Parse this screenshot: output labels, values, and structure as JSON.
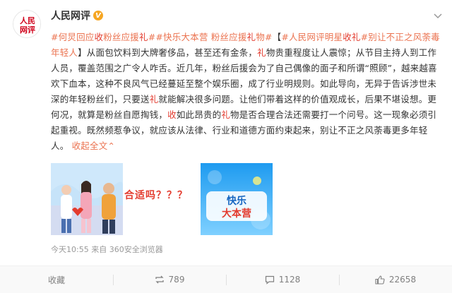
{
  "post": {
    "author": "人民网评",
    "verified_badge": "V",
    "logo_text": "人民\n网评",
    "body": {
      "t1": "#何炅回应",
      "t2": "收",
      "t3": "粉丝应援",
      "t4": "礼",
      "t5": "##快乐大本营 粉丝应援",
      "t6": "礼",
      "t7": "物#",
      "t8": "【",
      "t9": "#人民网评明星",
      "t10": "收礼",
      "t11": "#别让不正之风荼毒年轻人",
      "t12": "】从面包饮料到大牌奢侈品，甚至还有金条，",
      "t13": "礼",
      "t14": "物贵重程度让人震惊；从节目主持人到工作人员，覆盖范围之广令人咋舌。近几年，粉丝后援会为了自己偶像的面子和所谓“照顾”，越来越喜欢下血本，这种不良风气已经蔓延至整个娱乐圈，成了行业明规则。如此导向，无异于告诉涉世未深的年轻粉丝们，只要送",
      "t15": "礼",
      "t16": "就能解决很多问题。让他们带着这样的价值观成长，后果不堪设想。更何况，就算是粉丝自愿掏钱，",
      "t17": "收",
      "t18": "如此昂贵的",
      "t19": "礼",
      "t20": "物是否合理合法还需要打一个问号。这一现象必须引起重视。既然频惹争议，就应该从法律、行业和道德方面约束起来，别让不正之风荼毒更多年轻人。",
      "collapse": "收起全文",
      "collapse_arrow": "⌃"
    },
    "image_caption": "合适吗？？？",
    "image2_text": "快乐大本营",
    "meta": "今天10:55 来自 360安全浏览器"
  },
  "actions": {
    "favorite_label": "收藏",
    "repost_label": "转发",
    "repost_count": "789",
    "comment_label": "评论",
    "comment_count": "1128",
    "like_count": "22658"
  },
  "colors": {
    "topic": "#eb7350",
    "highlight": "#e33b2e",
    "badge": "#f6a623",
    "meta": "#999999"
  }
}
